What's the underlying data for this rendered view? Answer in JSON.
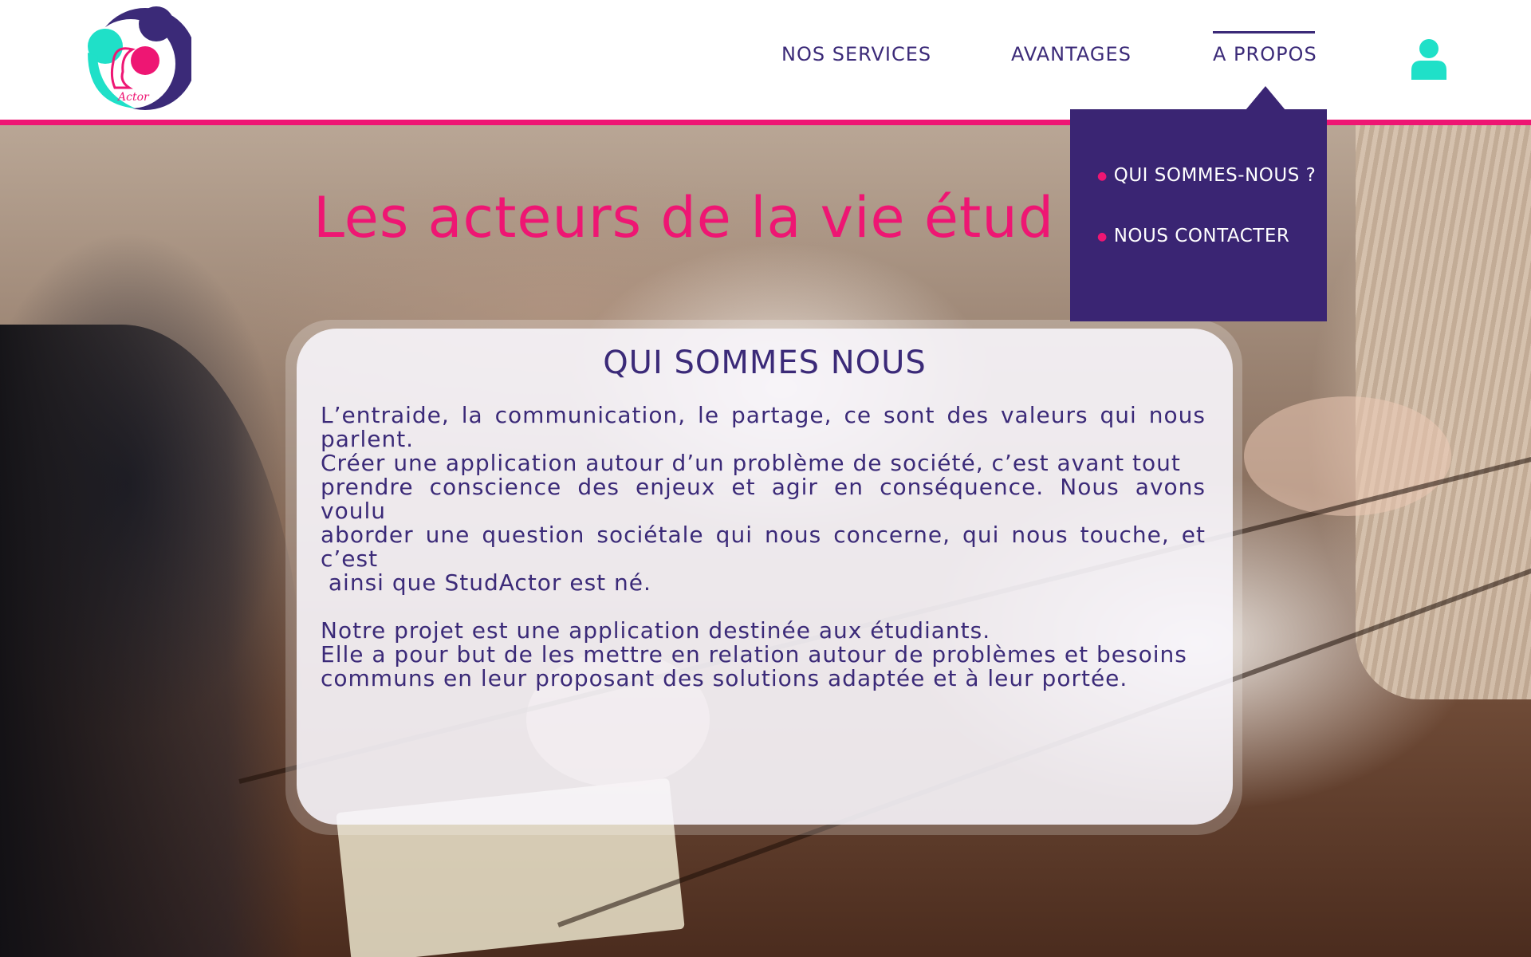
{
  "brand": {
    "logo_text": "Actor",
    "colors": {
      "primary": "#3b2a78",
      "accent": "#ee1673",
      "teal": "#1fe0c8"
    }
  },
  "nav": {
    "items": [
      {
        "label": "NOS SERVICES"
      },
      {
        "label": "AVANTAGES"
      },
      {
        "label": "A PROPOS",
        "active": true
      }
    ],
    "user_icon": "user-icon"
  },
  "dropdown": {
    "items": [
      {
        "label": "QUI SOMMES-NOUS ?"
      },
      {
        "label": "NOUS CONTACTER"
      }
    ]
  },
  "hero": {
    "title": "Les acteurs de la vie étud"
  },
  "card": {
    "title": "QUI SOMMES NOUS",
    "paragraph1": [
      "L’entraide, la communication, le partage, ce sont des valeurs qui nous parlent.",
      "Créer une application autour d’un problème de société, c’est avant tout",
      "prendre conscience des enjeux et agir en conséquence. Nous avons voulu",
      "aborder une question sociétale qui nous concerne, qui nous touche, et c’est",
      " ainsi que StudActor est né."
    ],
    "paragraph2": [
      "Notre projet est une application destinée aux étudiants.",
      "Elle a pour but de les mettre en relation autour de problèmes et besoins",
      "communs en leur proposant des solutions adaptée et à leur portée."
    ]
  }
}
